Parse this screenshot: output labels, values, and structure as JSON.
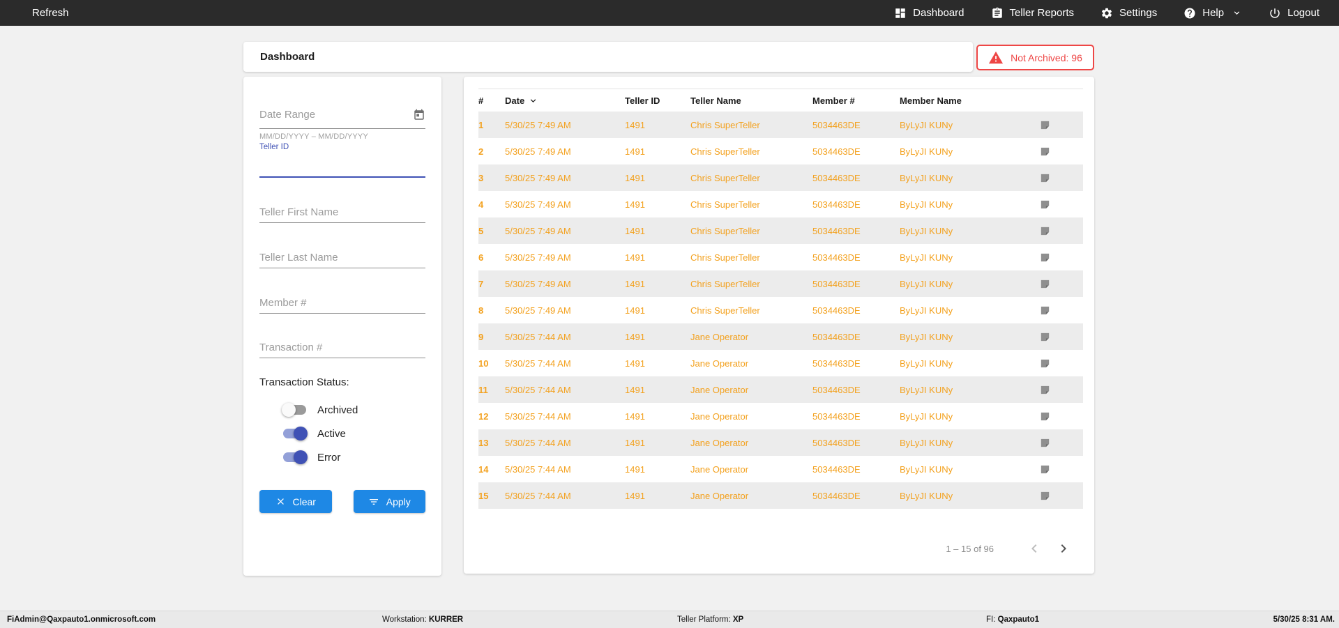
{
  "topbar": {
    "refresh_label": "Refresh",
    "items": [
      {
        "label": "Dashboard",
        "icon": "dashboard-icon"
      },
      {
        "label": "Teller Reports",
        "icon": "teller-reports-icon"
      },
      {
        "label": "Settings",
        "icon": "settings-icon"
      },
      {
        "label": "Help",
        "icon": "help-icon",
        "chevron": true
      },
      {
        "label": "Logout",
        "icon": "logout-icon"
      }
    ]
  },
  "header": {
    "title": "Dashboard",
    "badge": "Not Archived: 96",
    "badge_color": "#ee4645"
  },
  "filters": {
    "date_range_placeholder": "Date Range",
    "date_range_hint": "MM/DD/YYYY – MM/DD/YYYY",
    "teller_id_label": "Teller ID",
    "teller_first_name_placeholder": "Teller First Name",
    "teller_last_name_placeholder": "Teller Last Name",
    "member_number_placeholder": "Member #",
    "transaction_number_placeholder": "Transaction #",
    "status_label": "Transaction Status:",
    "toggles": [
      {
        "label": "Archived",
        "on": false
      },
      {
        "label": "Active",
        "on": true
      },
      {
        "label": "Error",
        "on": true
      }
    ],
    "clear_label": "Clear",
    "apply_label": "Apply",
    "accent_color": "#3f51b5",
    "button_color": "#1e88e5"
  },
  "table": {
    "columns": [
      {
        "label": "#"
      },
      {
        "label": "Date",
        "sorted": "desc"
      },
      {
        "label": "Teller ID"
      },
      {
        "label": "Teller Name"
      },
      {
        "label": "Member #"
      },
      {
        "label": "Member Name"
      }
    ],
    "row_text_color": "#f3a11e",
    "rows": [
      {
        "num": "1",
        "date": "5/30/25 7:49 AM",
        "teller_id": "1491",
        "teller_name": "Chris SuperTeller",
        "member_num": "5034463DE",
        "member_name": "ByLyJI KUNy"
      },
      {
        "num": "2",
        "date": "5/30/25 7:49 AM",
        "teller_id": "1491",
        "teller_name": "Chris SuperTeller",
        "member_num": "5034463DE",
        "member_name": "ByLyJI KUNy"
      },
      {
        "num": "3",
        "date": "5/30/25 7:49 AM",
        "teller_id": "1491",
        "teller_name": "Chris SuperTeller",
        "member_num": "5034463DE",
        "member_name": "ByLyJI KUNy"
      },
      {
        "num": "4",
        "date": "5/30/25 7:49 AM",
        "teller_id": "1491",
        "teller_name": "Chris SuperTeller",
        "member_num": "5034463DE",
        "member_name": "ByLyJI KUNy"
      },
      {
        "num": "5",
        "date": "5/30/25 7:49 AM",
        "teller_id": "1491",
        "teller_name": "Chris SuperTeller",
        "member_num": "5034463DE",
        "member_name": "ByLyJI KUNy"
      },
      {
        "num": "6",
        "date": "5/30/25 7:49 AM",
        "teller_id": "1491",
        "teller_name": "Chris SuperTeller",
        "member_num": "5034463DE",
        "member_name": "ByLyJI KUNy"
      },
      {
        "num": "7",
        "date": "5/30/25 7:49 AM",
        "teller_id": "1491",
        "teller_name": "Chris SuperTeller",
        "member_num": "5034463DE",
        "member_name": "ByLyJI KUNy"
      },
      {
        "num": "8",
        "date": "5/30/25 7:49 AM",
        "teller_id": "1491",
        "teller_name": "Chris SuperTeller",
        "member_num": "5034463DE",
        "member_name": "ByLyJI KUNy"
      },
      {
        "num": "9",
        "date": "5/30/25 7:44 AM",
        "teller_id": "1491",
        "teller_name": "Jane Operator",
        "member_num": "5034463DE",
        "member_name": "ByLyJI KUNy"
      },
      {
        "num": "10",
        "date": "5/30/25 7:44 AM",
        "teller_id": "1491",
        "teller_name": "Jane Operator",
        "member_num": "5034463DE",
        "member_name": "ByLyJI KUNy"
      },
      {
        "num": "11",
        "date": "5/30/25 7:44 AM",
        "teller_id": "1491",
        "teller_name": "Jane Operator",
        "member_num": "5034463DE",
        "member_name": "ByLyJI KUNy"
      },
      {
        "num": "12",
        "date": "5/30/25 7:44 AM",
        "teller_id": "1491",
        "teller_name": "Jane Operator",
        "member_num": "5034463DE",
        "member_name": "ByLyJI KUNy"
      },
      {
        "num": "13",
        "date": "5/30/25 7:44 AM",
        "teller_id": "1491",
        "teller_name": "Jane Operator",
        "member_num": "5034463DE",
        "member_name": "ByLyJI KUNy"
      },
      {
        "num": "14",
        "date": "5/30/25 7:44 AM",
        "teller_id": "1491",
        "teller_name": "Jane Operator",
        "member_num": "5034463DE",
        "member_name": "ByLyJI KUNy"
      },
      {
        "num": "15",
        "date": "5/30/25 7:44 AM",
        "teller_id": "1491",
        "teller_name": "Jane Operator",
        "member_num": "5034463DE",
        "member_name": "ByLyJI KUNy"
      }
    ],
    "pagination": "1 – 15 of 96"
  },
  "statusbar": {
    "user": "FiAdmin@Qaxpauto1.onmicrosoft.com",
    "workstation_label": "Workstation: ",
    "workstation": "KURRER",
    "platform_label": "Teller Platform: ",
    "platform": "XP",
    "fi_label": "FI: ",
    "fi": "Qaxpauto1",
    "datetime": "5/30/25 8:31 AM."
  }
}
